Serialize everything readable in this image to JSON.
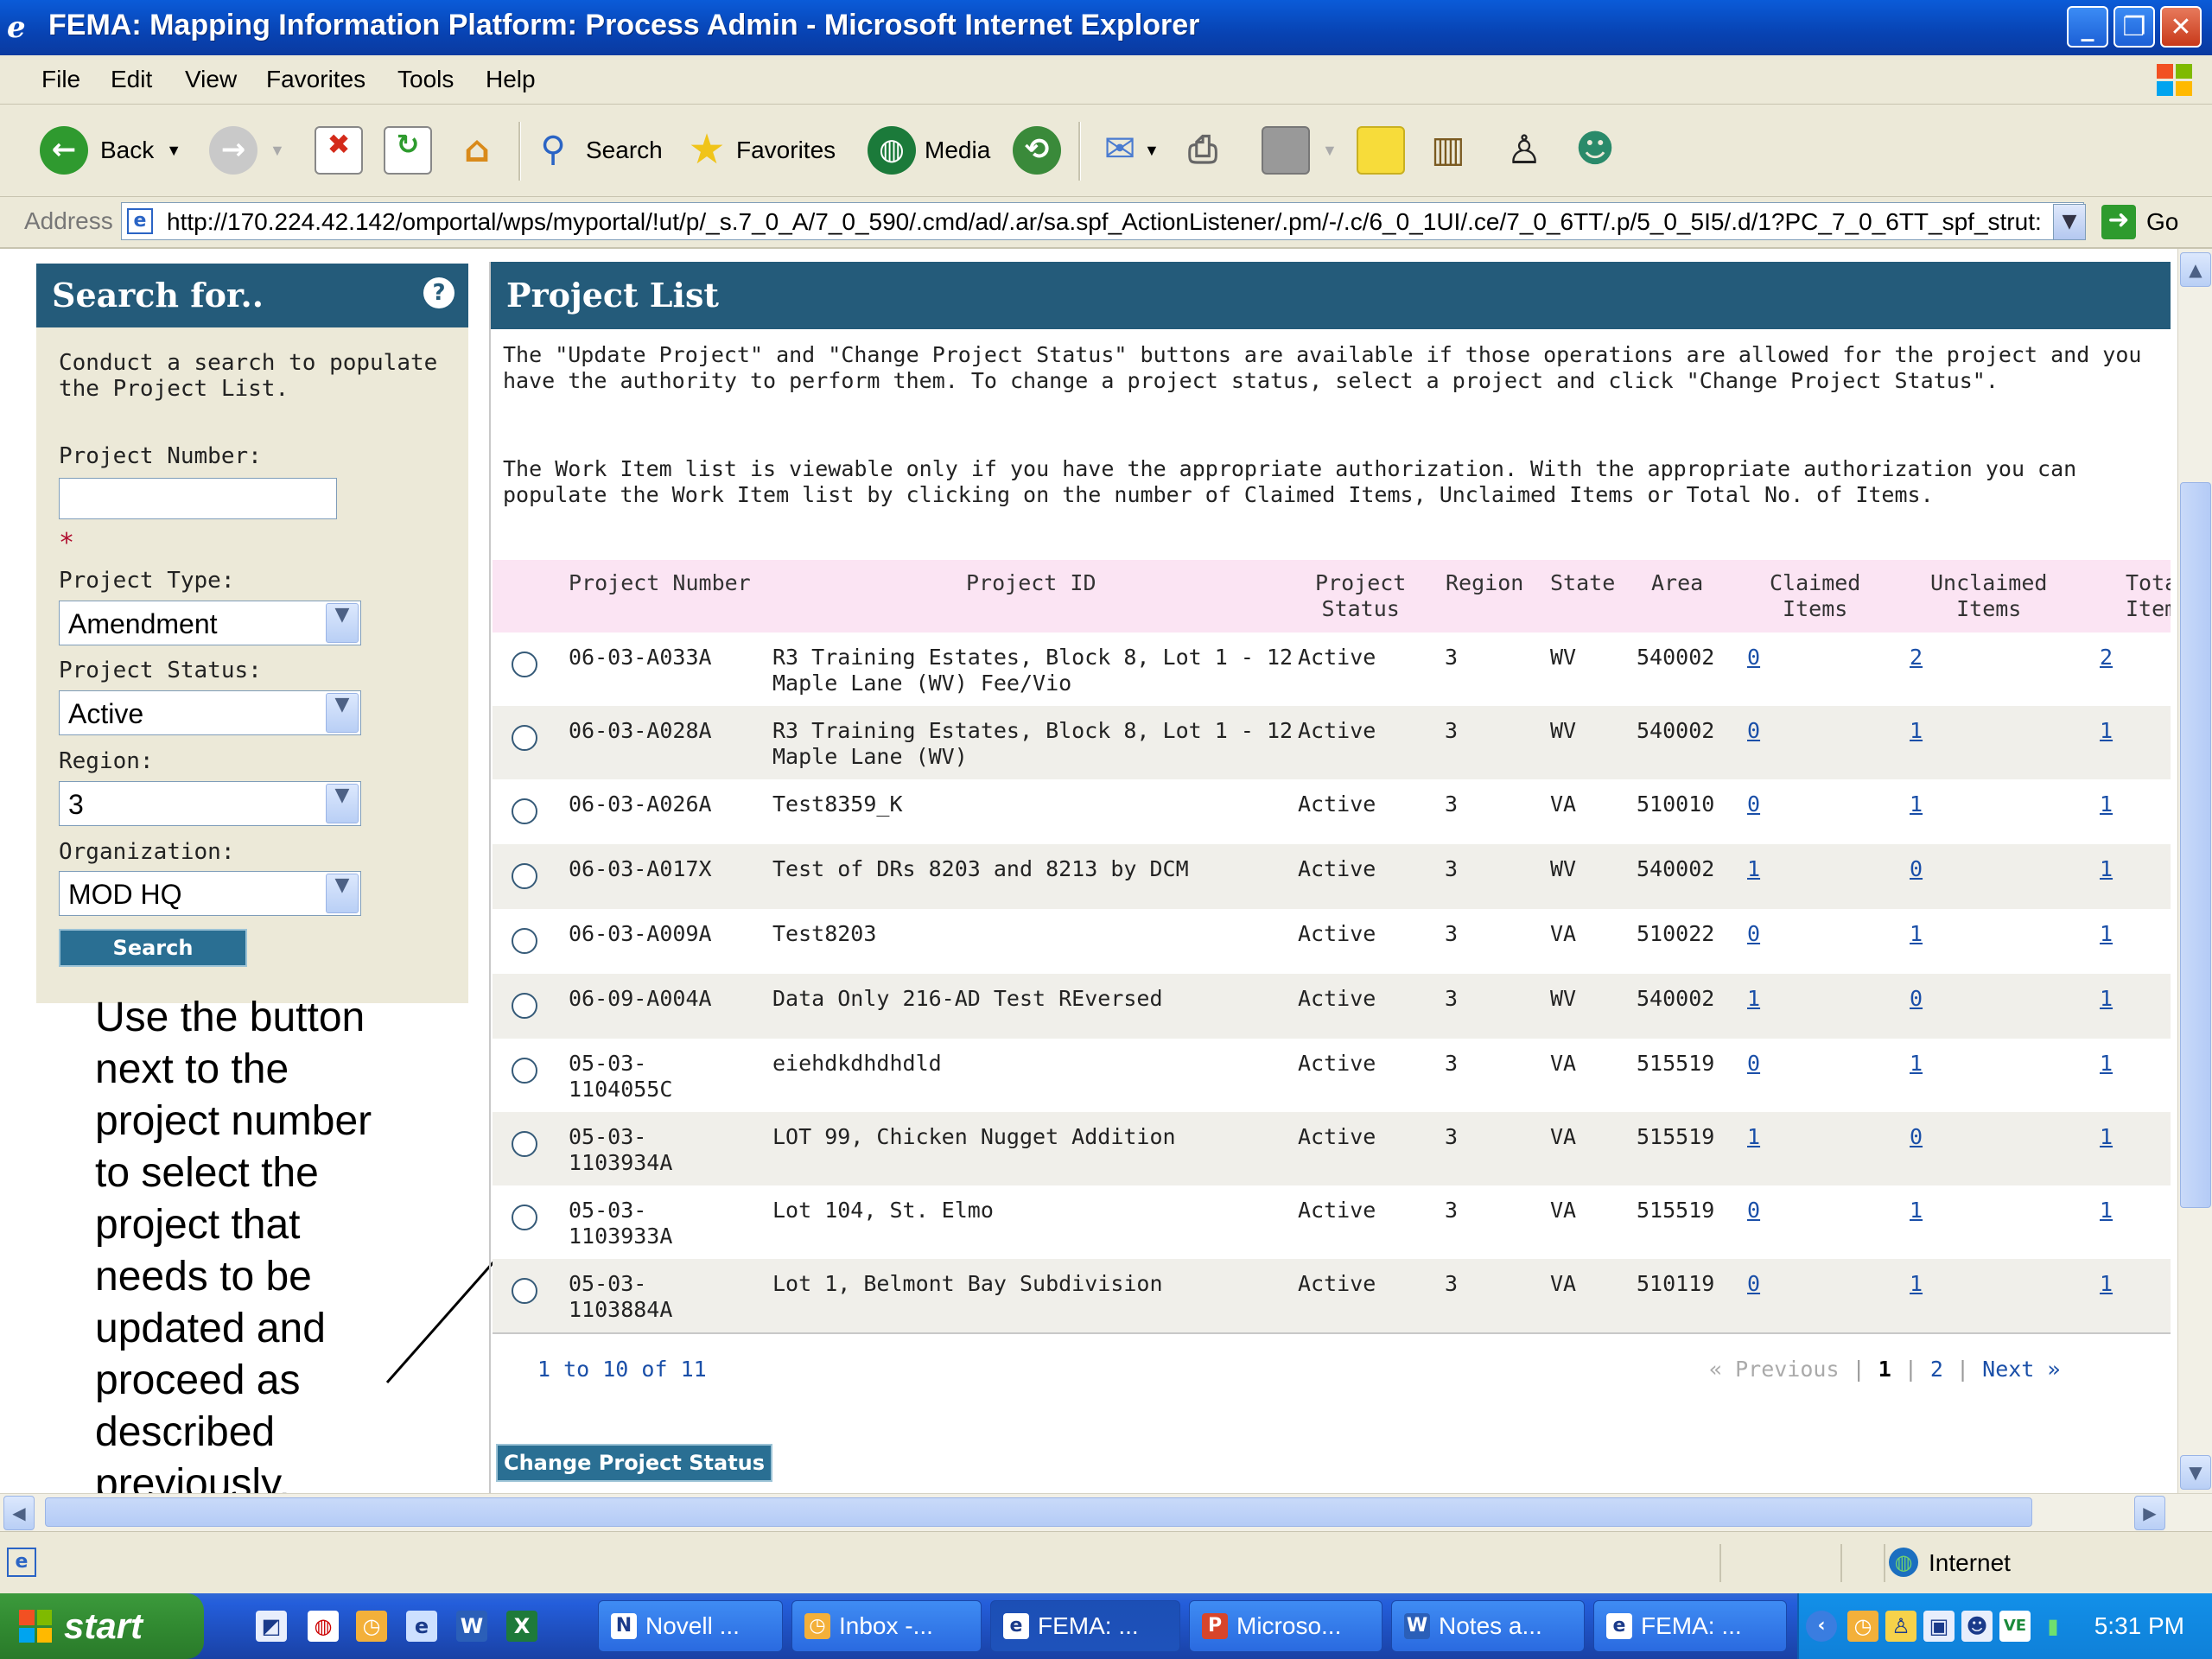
{
  "window": {
    "title": "FEMA: Mapping Information Platform: Process Admin - Microsoft Internet Explorer",
    "app_icon": "ie-icon",
    "controls": [
      "minimize",
      "maximize",
      "close"
    ]
  },
  "menu": {
    "items": [
      "File",
      "Edit",
      "View",
      "Favorites",
      "Tools",
      "Help"
    ]
  },
  "toolbar": {
    "back": "Back",
    "search": "Search",
    "favorites": "Favorites",
    "media": "Media"
  },
  "address": {
    "label": "Address",
    "url": "http://170.224.42.142/omportal/wps/myportal/!ut/p/_s.7_0_A/7_0_590/.cmd/ad/.ar/sa.spf_ActionListener/.pm/-/.c/6_0_1UI/.ce/7_0_6TT/.p/5_0_5I5/.d/1?PC_7_0_6TT_spf_strut:",
    "go": "Go"
  },
  "search_panel": {
    "title": "Search for..",
    "intro": "Conduct a search to populate the Project List.",
    "project_number_label": "Project Number:",
    "project_number_value": "",
    "required_mark": "*",
    "project_type_label": "Project Type:",
    "project_type_value": "Amendment",
    "project_status_label": "Project Status:",
    "project_status_value": "Active",
    "region_label": "Region:",
    "region_value": "3",
    "organization_label": "Organization:",
    "organization_value": "MOD HQ",
    "search_button": "Search"
  },
  "callout": {
    "text": "Use the button next to the project number to select the project that needs to be updated and proceed as described previously."
  },
  "project_list": {
    "title": "Project List",
    "info1": "The \"Update Project\" and \"Change Project Status\" buttons are available if those operations are allowed for the project and you have the authority to perform them. To change a project status, select a project and click \"Change Project Status\".",
    "info2": "The Work Item list is viewable only if you have the appropriate authorization. With the appropriate authorization you can populate the Work Item list by clicking on the number of Claimed Items, Unclaimed Items or Total No. of Items.",
    "columns": {
      "project_number": "Project Number",
      "project_id": "Project ID",
      "project_status": "Project\nStatus",
      "region": "Region",
      "state": "State",
      "area": "Area",
      "claimed": "Claimed\nItems",
      "unclaimed": "Unclaimed\nItems",
      "total": "Total\nItems"
    },
    "rows": [
      {
        "number": "06-03-A033A",
        "id": "R3 Training Estates, Block 8, Lot 1 - 12\nMaple Lane (WV) Fee/Vio",
        "status": "Active",
        "region": "3",
        "state": "WV",
        "area": "540002",
        "claimed": "0",
        "unclaimed": "2",
        "total": "2"
      },
      {
        "number": "06-03-A028A",
        "id": "R3 Training Estates, Block 8, Lot 1 - 12\nMaple Lane (WV)",
        "status": "Active",
        "region": "3",
        "state": "WV",
        "area": "540002",
        "claimed": "0",
        "unclaimed": "1",
        "total": "1"
      },
      {
        "number": "06-03-A026A",
        "id": "Test8359_K",
        "status": "Active",
        "region": "3",
        "state": "VA",
        "area": "510010",
        "claimed": "0",
        "unclaimed": "1",
        "total": "1"
      },
      {
        "number": "06-03-A017X",
        "id": "Test of DRs 8203 and 8213 by DCM",
        "status": "Active",
        "region": "3",
        "state": "WV",
        "area": "540002",
        "claimed": "1",
        "unclaimed": "0",
        "total": "1"
      },
      {
        "number": "06-03-A009A",
        "id": "Test8203",
        "status": "Active",
        "region": "3",
        "state": "VA",
        "area": "510022",
        "claimed": "0",
        "unclaimed": "1",
        "total": "1"
      },
      {
        "number": "06-09-A004A",
        "id": "Data Only 216-AD Test REversed",
        "status": "Active",
        "region": "3",
        "state": "WV",
        "area": "540002",
        "claimed": "1",
        "unclaimed": "0",
        "total": "1"
      },
      {
        "number": "05-03-\n1104055C",
        "id": "eiehdkdhdhdld",
        "status": "Active",
        "region": "3",
        "state": "VA",
        "area": "515519",
        "claimed": "0",
        "unclaimed": "1",
        "total": "1"
      },
      {
        "number": "05-03-\n1103934A",
        "id": "LOT 99, Chicken Nugget Addition",
        "status": "Active",
        "region": "3",
        "state": "VA",
        "area": "515519",
        "claimed": "1",
        "unclaimed": "0",
        "total": "1"
      },
      {
        "number": "05-03-\n1103933A",
        "id": "Lot 104, St. Elmo",
        "status": "Active",
        "region": "3",
        "state": "VA",
        "area": "515519",
        "claimed": "0",
        "unclaimed": "1",
        "total": "1"
      },
      {
        "number": "05-03-\n1103884A",
        "id": "Lot 1, Belmont Bay Subdivision",
        "status": "Active",
        "region": "3",
        "state": "VA",
        "area": "510119",
        "claimed": "0",
        "unclaimed": "1",
        "total": "1"
      }
    ],
    "range_text": "1 to 10 of 11",
    "pager": {
      "previous": "« Previous",
      "pages": [
        "1",
        "2"
      ],
      "current": "1",
      "next": "Next »"
    },
    "change_status_button": "Change Project Status"
  },
  "statusbar": {
    "zone": "Internet"
  },
  "taskbar": {
    "start": "start",
    "tasks": [
      "Novell ...",
      "Inbox -...",
      "FEMA: ...",
      "Microso...",
      "Notes a...",
      "FEMA: ..."
    ],
    "active_task": "FEMA: ...",
    "clock": "5:31 PM"
  },
  "colors": {
    "header_blue": "#245b7a",
    "table_header_pink": "#fbe4f3",
    "link_blue": "#1a4fa8"
  }
}
